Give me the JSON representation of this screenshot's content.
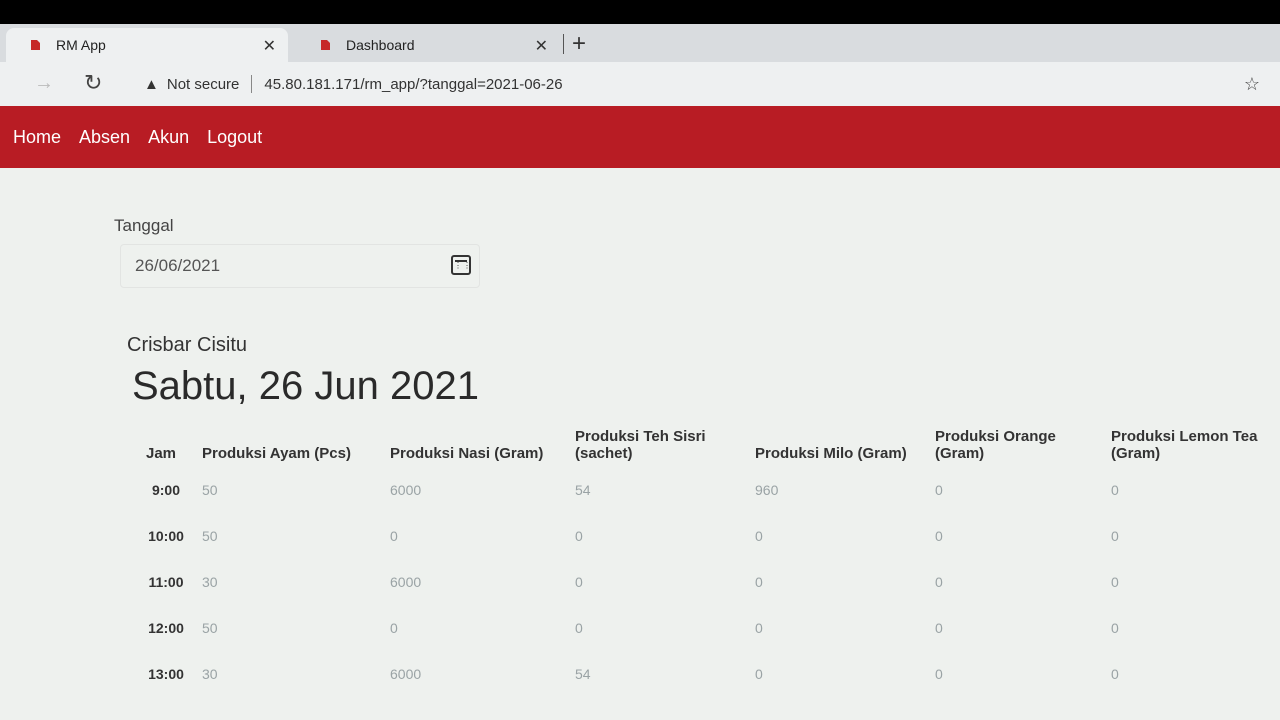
{
  "browser": {
    "tabs": [
      {
        "title": "RM App",
        "active": true
      },
      {
        "title": "Dashboard",
        "active": false
      }
    ],
    "security_label": "Not secure",
    "url": "45.80.181.171/rm_app/?tanggal=2021-06-26",
    "accent": "#b81c24"
  },
  "nav": {
    "items": [
      "Home",
      "Absen",
      "Akun",
      "Logout"
    ]
  },
  "form": {
    "label": "Tanggal",
    "date_value": "26/06/2021"
  },
  "location": "Crisbar Cisitu",
  "date_heading": "Sabtu, 26 Jun 2021",
  "table": {
    "headers": [
      "Jam",
      "Produksi Ayam (Pcs)",
      "Produksi Nasi (Gram)",
      "Produksi Teh Sisri (sachet)",
      "Produksi Milo (Gram)",
      "Produksi Orange (Gram)",
      "Produksi Lemon Tea (Gram)"
    ],
    "rows": [
      [
        "9:00",
        "50",
        "6000",
        "54",
        "960",
        "0",
        "0"
      ],
      [
        "10:00",
        "50",
        "0",
        "0",
        "0",
        "0",
        "0"
      ],
      [
        "11:00",
        "30",
        "6000",
        "0",
        "0",
        "0",
        "0"
      ],
      [
        "12:00",
        "50",
        "0",
        "0",
        "0",
        "0",
        "0"
      ],
      [
        "13:00",
        "30",
        "6000",
        "54",
        "0",
        "0",
        "0"
      ]
    ]
  }
}
